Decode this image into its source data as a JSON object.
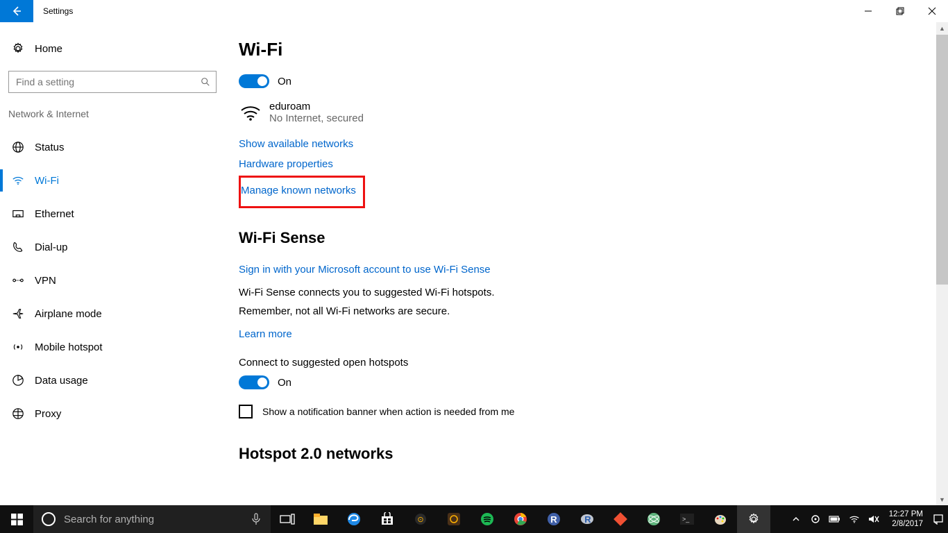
{
  "titlebar": {
    "title": "Settings"
  },
  "sidebar": {
    "home": "Home",
    "search_placeholder": "Find a setting",
    "category": "Network & Internet",
    "items": [
      {
        "label": "Status"
      },
      {
        "label": "Wi-Fi"
      },
      {
        "label": "Ethernet"
      },
      {
        "label": "Dial-up"
      },
      {
        "label": "VPN"
      },
      {
        "label": "Airplane mode"
      },
      {
        "label": "Mobile hotspot"
      },
      {
        "label": "Data usage"
      },
      {
        "label": "Proxy"
      }
    ]
  },
  "main": {
    "wifi_heading": "Wi-Fi",
    "wifi_toggle": "On",
    "network_name": "eduroam",
    "network_status": "No Internet, secured",
    "link_show_networks": "Show available networks",
    "link_hw_properties": "Hardware properties",
    "link_manage_known": "Manage known networks",
    "wifisense_heading": "Wi-Fi Sense",
    "link_signin": "Sign in with your Microsoft account to use Wi-Fi Sense",
    "wifisense_desc": "Wi-Fi Sense connects you to suggested Wi-Fi hotspots.",
    "wifisense_remember": "Remember, not all Wi-Fi networks are secure.",
    "link_learn_more": "Learn more",
    "open_hotspots_label": "Connect to suggested open hotspots",
    "open_hotspots_toggle": "On",
    "notification_checkbox": "Show a notification banner when action is needed from me",
    "hotspot20_heading": "Hotspot 2.0 networks"
  },
  "taskbar": {
    "cortana_placeholder": "Search for anything",
    "time": "12:27 PM",
    "date": "2/8/2017"
  }
}
